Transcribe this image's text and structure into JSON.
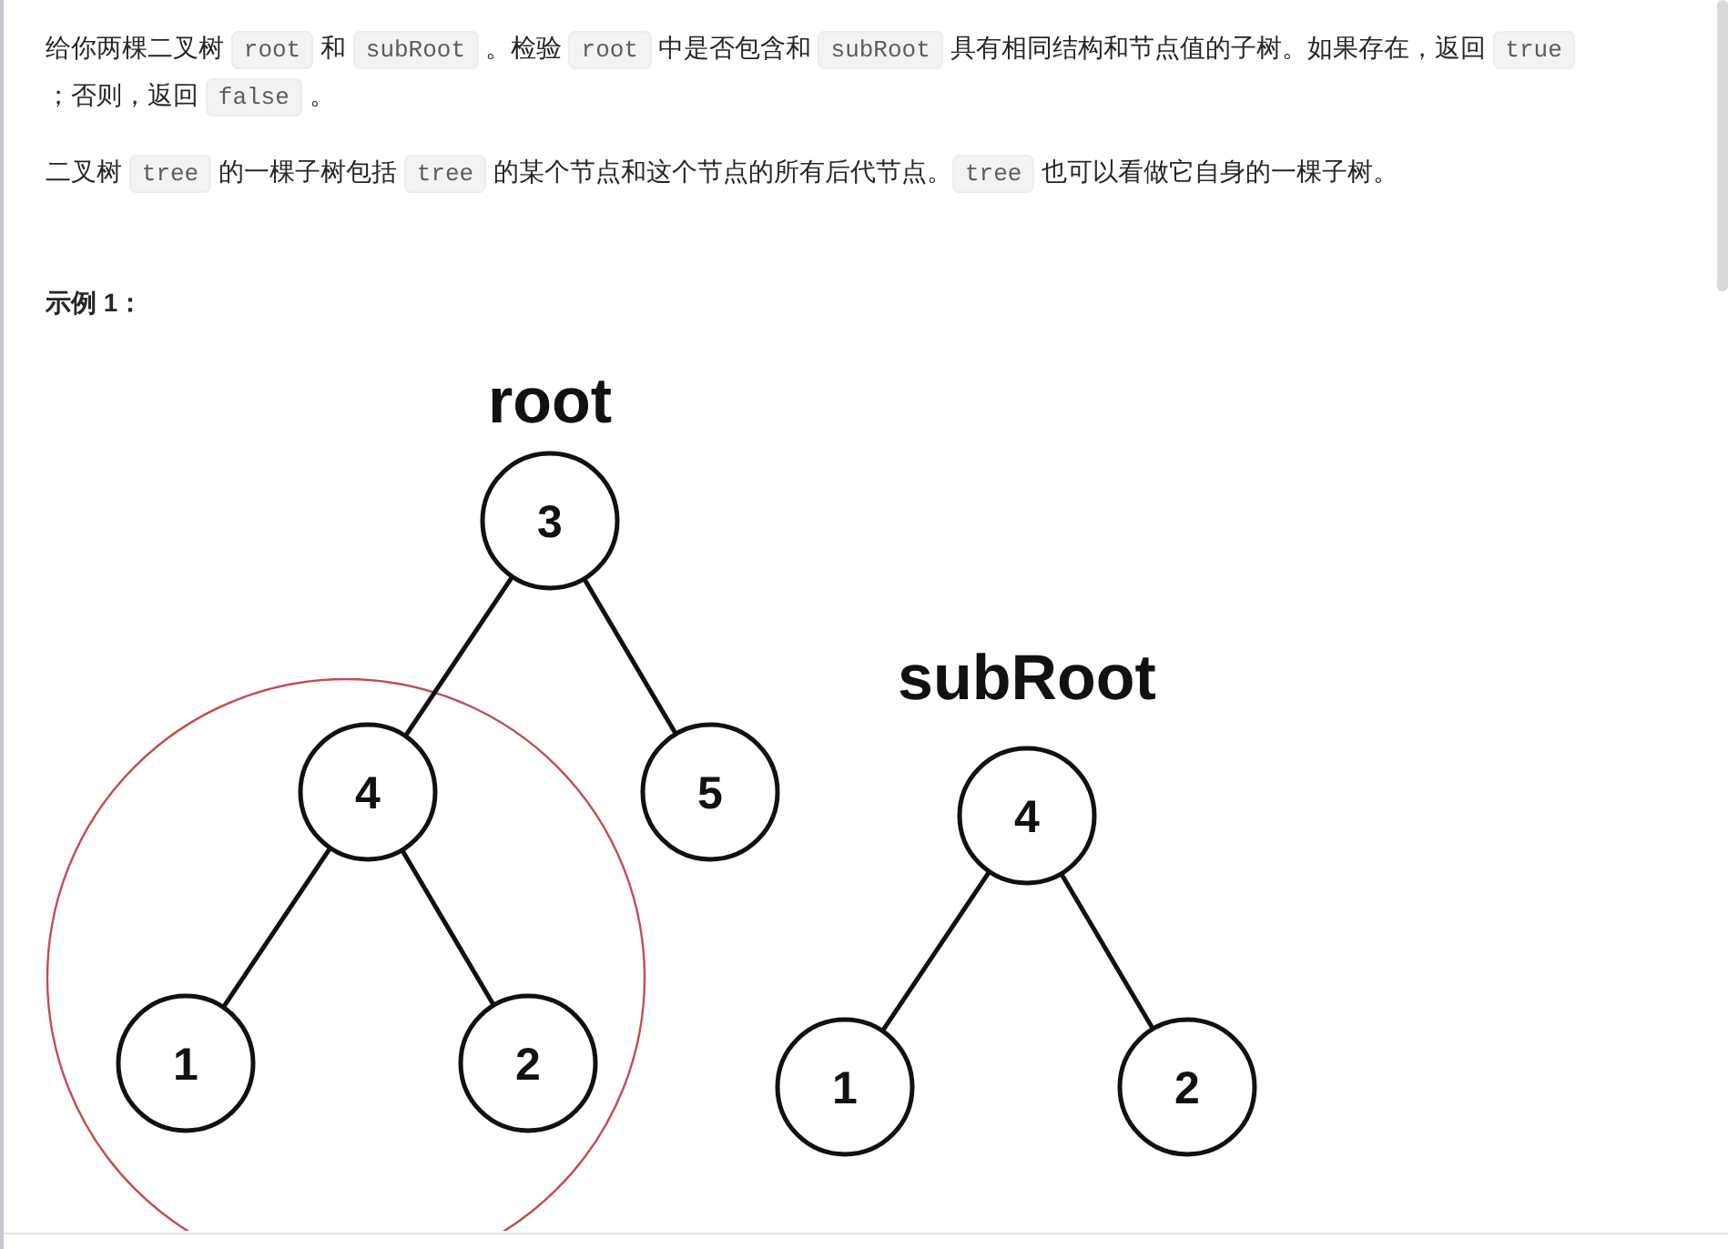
{
  "paragraphs": [
    {
      "segments": [
        {
          "kind": "text",
          "text": "给你两棵二叉树 "
        },
        {
          "kind": "code",
          "text": "root"
        },
        {
          "kind": "text",
          "text": " 和 "
        },
        {
          "kind": "code",
          "text": "subRoot"
        },
        {
          "kind": "text",
          "text": " 。检验 "
        },
        {
          "kind": "code",
          "text": "root"
        },
        {
          "kind": "text",
          "text": " 中是否包含和 "
        },
        {
          "kind": "code",
          "text": "subRoot"
        },
        {
          "kind": "text",
          "text": " 具有相同结构和节点值的子树。如果存在，返回 "
        },
        {
          "kind": "code",
          "text": "true"
        },
        {
          "kind": "text",
          "text": " ；否则，返回 "
        },
        {
          "kind": "code",
          "text": "false"
        },
        {
          "kind": "text",
          "text": " 。"
        }
      ]
    },
    {
      "segments": [
        {
          "kind": "text",
          "text": "二叉树 "
        },
        {
          "kind": "code",
          "text": "tree"
        },
        {
          "kind": "text",
          "text": " 的一棵子树包括 "
        },
        {
          "kind": "code",
          "text": "tree"
        },
        {
          "kind": "text",
          "text": " 的某个节点和这个节点的所有后代节点。"
        },
        {
          "kind": "code",
          "text": "tree"
        },
        {
          "kind": "text",
          "text": " 也可以看做它自身的一棵子树。"
        }
      ]
    }
  ],
  "example_heading": "示例 1：",
  "diagram": {
    "trees": [
      {
        "label": "root",
        "node": {
          "value": "3",
          "highlighted": false,
          "children": [
            {
              "value": "4",
              "highlighted": true,
              "children": [
                {
                  "value": "1",
                  "highlighted": false
                },
                {
                  "value": "2",
                  "highlighted": false
                }
              ]
            },
            {
              "value": "5",
              "highlighted": false
            }
          ]
        }
      },
      {
        "label": "subRoot",
        "node": {
          "value": "4",
          "highlighted": false,
          "children": [
            {
              "value": "1",
              "highlighted": false
            },
            {
              "value": "2",
              "highlighted": false
            }
          ]
        }
      }
    ]
  }
}
